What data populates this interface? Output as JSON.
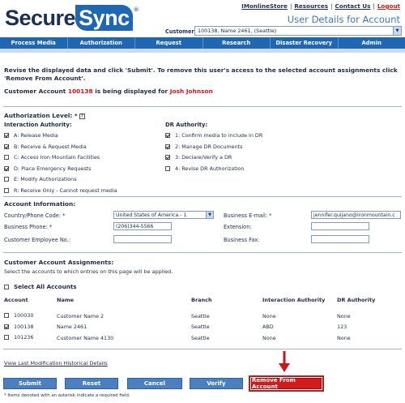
{
  "header": {
    "logo": {
      "part1": "Secure",
      "part2": "Sync",
      "reg": "®"
    },
    "links": [
      "IMonlineStore",
      "Resources",
      "Contact Us",
      "Logout"
    ],
    "page_title": "User Details for Account",
    "customer_label": "Customer:",
    "customer_value": "100138, Name 2461, (Seattle)"
  },
  "nav": [
    "Process Media",
    "Authorization",
    "Request",
    "Research",
    "Disaster Recovery",
    "Admin"
  ],
  "instructions": "Revise the displayed data and click 'Submit'.  To remove this user's access to the selected account assignments click 'Remove From Account'.",
  "account_line": {
    "prefix": "Customer Account ",
    "account": "100138",
    "middle": " is being displayed for ",
    "user": "Josh Johnson"
  },
  "authorization": {
    "heading": "Authorization Level: *",
    "help_icon": "?",
    "interaction_heading": "Interaction Authority:",
    "interaction": [
      {
        "label": "A: Release Media",
        "checked": true
      },
      {
        "label": "B: Receive & Request Media",
        "checked": true
      },
      {
        "label": "C: Access Iron Mountain Facilities",
        "checked": false
      },
      {
        "label": "D: Place Emergency Requests",
        "checked": true
      },
      {
        "label": "E: Modify Authorizations",
        "checked": false
      },
      {
        "label": "R: Receive Only - Cannot request media",
        "checked": false
      }
    ],
    "dr_heading": "DR Authority:",
    "dr": [
      {
        "label": "1: Confirm media to include in DR",
        "checked": true
      },
      {
        "label": "2: Manage DR Documents",
        "checked": true
      },
      {
        "label": "3: Declare/Verify a DR",
        "checked": true
      },
      {
        "label": "4: Revise DR Authorization",
        "checked": false
      }
    ]
  },
  "account_info": {
    "heading": "Account Information:",
    "country_label": "Country/Phone Code: *",
    "country_value": "United States of America - 1",
    "business_phone_label": "Business Phone: *",
    "business_phone_value": "(206)344-5566",
    "employee_no_label": "Customer Employee No.:",
    "employee_no_value": "",
    "email_label": "Business E-mail: *",
    "email_value": "jennifer.quijano@ironmountain.c",
    "extension_label": "Extension:",
    "extension_value": "",
    "fax_label": "Business Fax:",
    "fax_value": ""
  },
  "assignments": {
    "heading": "Customer Account Assignments:",
    "subtext": "Select the accounts to which entries on this page will be applied.",
    "select_all": "Select All Accounts",
    "columns": [
      "Account",
      "Name",
      "Branch",
      "Interaction Authority",
      "DR Authority"
    ],
    "rows": [
      {
        "checked": false,
        "account": "100030",
        "name": "Customer Name 2",
        "branch": "Seattle",
        "interaction": "None",
        "dr": "None"
      },
      {
        "checked": true,
        "account": "100138",
        "name": "Name 2461",
        "branch": "Seattle",
        "interaction": "ABD",
        "dr": "123"
      },
      {
        "checked": false,
        "account": "101236",
        "name": "Customer Name 4130",
        "branch": "Seattle",
        "interaction": "None",
        "dr": "None"
      }
    ]
  },
  "history_link": "View Last Modification Historical Details",
  "buttons": {
    "submit": "Submit",
    "reset": "Reset",
    "cancel": "Cancel",
    "verify": "Verify",
    "remove": "Remove From Account"
  },
  "footnote": "* Items denoted with an asterisk indicate a required field.",
  "colors": {
    "brand_blue": "#1f66b3",
    "accent_red": "#d4141a",
    "button_blue": "#4b7fc0"
  }
}
